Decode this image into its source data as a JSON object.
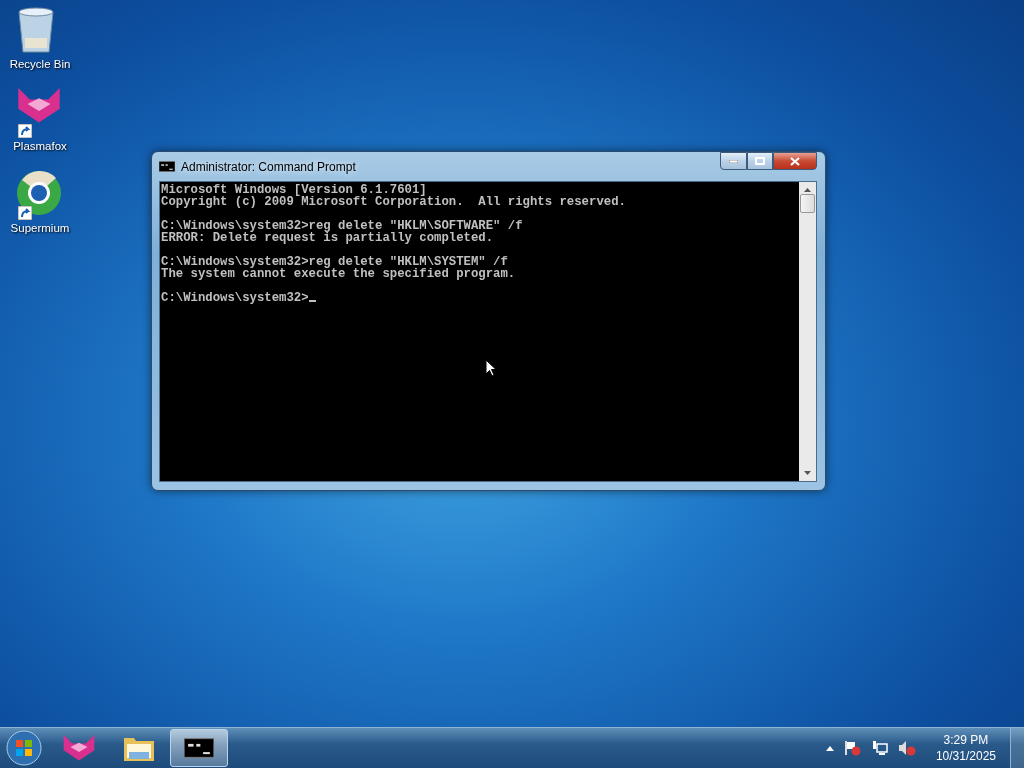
{
  "desktop_icons": [
    {
      "label": "Recycle Bin",
      "kind": "bin",
      "shortcut": false
    },
    {
      "label": "Plasmafox",
      "kind": "fox",
      "shortcut": true
    },
    {
      "label": "Supermium",
      "kind": "globe",
      "shortcut": true
    }
  ],
  "window": {
    "title": "Administrator: Command Prompt",
    "console_blocks": [
      [
        "Microsoft Windows [Version 6.1.7601]",
        "Copyright (c) 2009 Microsoft Corporation.  All rights reserved."
      ],
      [
        "C:\\Windows\\system32>reg delete \"HKLM\\SOFTWARE\" /f",
        "ERROR: Delete request is partially completed."
      ],
      [
        "C:\\Windows\\system32>reg delete \"HKLM\\SYSTEM\" /f",
        "The system cannot execute the specified program."
      ]
    ],
    "prompt": "C:\\Windows\\system32>"
  },
  "taskbar": {
    "buttons": [
      {
        "kind": "fox",
        "active": false
      },
      {
        "kind": "folder",
        "active": false
      },
      {
        "kind": "console",
        "active": true
      }
    ]
  },
  "tray": {
    "time": "3:29 PM",
    "date": "10/31/2025"
  }
}
